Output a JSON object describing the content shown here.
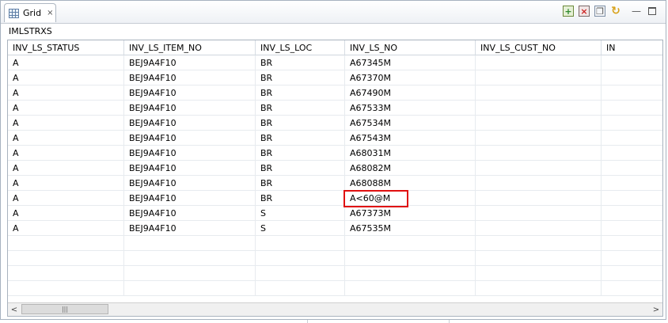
{
  "tab": {
    "label": "Grid",
    "close": "⨯"
  },
  "toolbar": {
    "add_label": "+",
    "delete_label": "×",
    "copy_label": "❐",
    "refresh_label": "↻",
    "minimize_label": "—"
  },
  "table_name": "IMLSTRXS",
  "grid": {
    "columns": [
      "INV_LS_STATUS",
      "INV_LS_ITEM_NO",
      "INV_LS_LOC",
      "INV_LS_NO",
      "INV_LS_CUST_NO",
      "IN"
    ],
    "rows": [
      [
        "A",
        "BEJ9A4F10",
        "BR",
        "A67345M",
        ""
      ],
      [
        "A",
        "BEJ9A4F10",
        "BR",
        "A67370M",
        ""
      ],
      [
        "A",
        "BEJ9A4F10",
        "BR",
        "A67490M",
        ""
      ],
      [
        "A",
        "BEJ9A4F10",
        "BR",
        "A67533M",
        ""
      ],
      [
        "A",
        "BEJ9A4F10",
        "BR",
        "A67534M",
        ""
      ],
      [
        "A",
        "BEJ9A4F10",
        "BR",
        "A67543M",
        ""
      ],
      [
        "A",
        "BEJ9A4F10",
        "BR",
        "A68031M",
        ""
      ],
      [
        "A",
        "BEJ9A4F10",
        "BR",
        "A68082M",
        ""
      ],
      [
        "A",
        "BEJ9A4F10",
        "BR",
        "A68088M",
        ""
      ],
      [
        "A",
        "BEJ9A4F10",
        "BR",
        "A<60@M",
        ""
      ],
      [
        "A",
        "BEJ9A4F10",
        "S",
        "A67373M",
        ""
      ],
      [
        "A",
        "BEJ9A4F10",
        "S",
        "A67535M",
        ""
      ]
    ],
    "highlighted_row": 9,
    "highlighted_col": 3
  },
  "scrollbar": {
    "left_arrow": "<",
    "right_arrow": ">",
    "thumb_grip": "|||"
  },
  "colors": {
    "highlight": "#e01010",
    "border": "#a9b3be"
  },
  "icons": {
    "tab": "grid-icon",
    "close": "close-icon",
    "add": "add-row-icon",
    "delete": "delete-row-icon",
    "copy": "copy-icon",
    "refresh": "refresh-icon",
    "minimize": "minimize-icon",
    "maximize": "maximize-icon"
  }
}
